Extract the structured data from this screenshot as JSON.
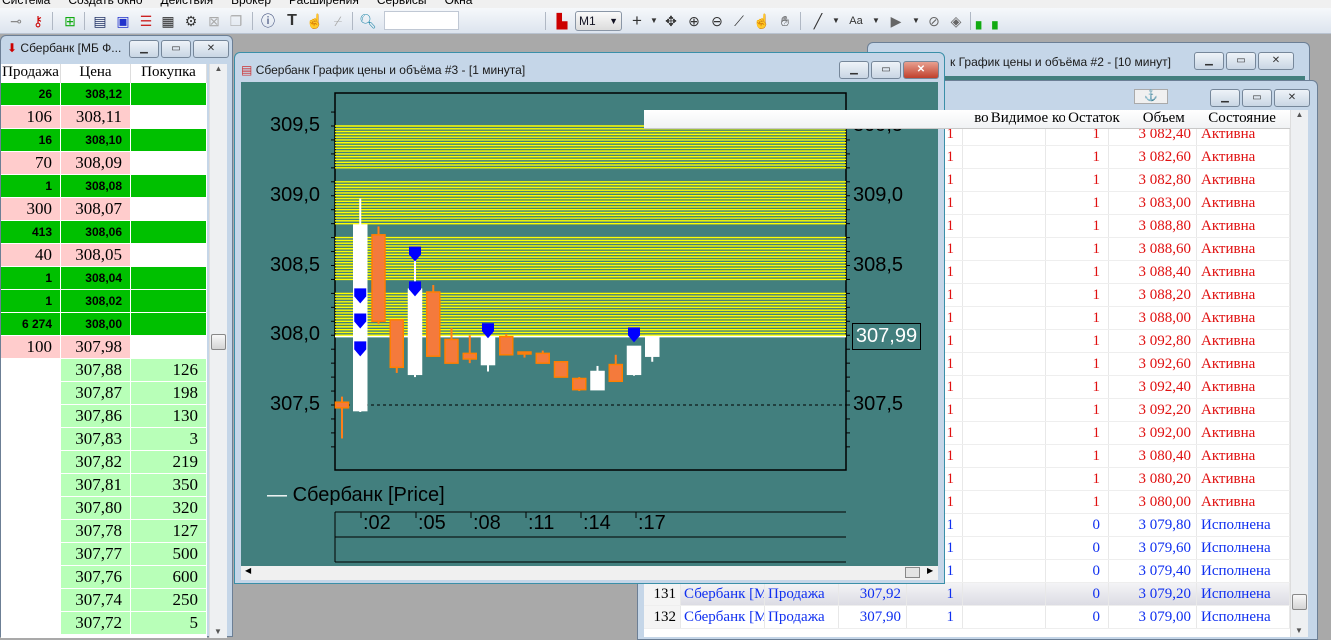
{
  "menu": [
    "Система",
    "Создать окно",
    "Действия",
    "Брокер",
    "Расширения",
    "Сервисы",
    "Окна"
  ],
  "toolbar": {
    "timeframe": "M1",
    "search_value": "",
    "font_button": "Aa"
  },
  "orderbook": {
    "title": "Сбербанк [МБ Ф...",
    "columns": [
      "Продажа",
      "Цена",
      "Покупка"
    ],
    "asks": [
      {
        "sell": "26",
        "price": "308,12",
        "style": "g"
      },
      {
        "sell": "106",
        "price": "308,11",
        "style": "p"
      },
      {
        "sell": "16",
        "price": "308,10",
        "style": "g"
      },
      {
        "sell": "70",
        "price": "308,09",
        "style": "p"
      },
      {
        "sell": "1",
        "price": "308,08",
        "style": "g"
      },
      {
        "sell": "300",
        "price": "308,07",
        "style": "p"
      },
      {
        "sell": "413",
        "price": "308,06",
        "style": "g"
      },
      {
        "sell": "40",
        "price": "308,05",
        "style": "p"
      },
      {
        "sell": "1",
        "price": "308,04",
        "style": "g"
      },
      {
        "sell": "1",
        "price": "308,02",
        "style": "g"
      },
      {
        "sell": "6 274",
        "price": "308,00",
        "style": "g"
      },
      {
        "sell": "100",
        "price": "307,98",
        "style": "p"
      }
    ],
    "bids": [
      {
        "price": "307,88",
        "buy": "126"
      },
      {
        "price": "307,87",
        "buy": "198"
      },
      {
        "price": "307,86",
        "buy": "130"
      },
      {
        "price": "307,83",
        "buy": "3"
      },
      {
        "price": "307,82",
        "buy": "219"
      },
      {
        "price": "307,81",
        "buy": "350"
      },
      {
        "price": "307,80",
        "buy": "320"
      },
      {
        "price": "307,78",
        "buy": "127"
      },
      {
        "price": "307,77",
        "buy": "500"
      },
      {
        "price": "307,76",
        "buy": "600"
      },
      {
        "price": "307,74",
        "buy": "250"
      },
      {
        "price": "307,72",
        "buy": "5"
      }
    ]
  },
  "chart2": {
    "title": "к График цены и объёма #2 - [10 минут]"
  },
  "chart3": {
    "title": "Сбербанк График цены и объёма #3 - [1 минута]",
    "legend": "Сбербанк [Price]",
    "last_price": "307,99"
  },
  "orders": {
    "columns": [
      "во",
      "Видимое ко.",
      "Остаток",
      "Объем",
      "Состояние"
    ],
    "rows": [
      {
        "qty": "1",
        "rest": "1",
        "vol": "3 082,40",
        "state": "Активна",
        "s": "act"
      },
      {
        "qty": "1",
        "rest": "1",
        "vol": "3 082,60",
        "state": "Активна",
        "s": "act"
      },
      {
        "qty": "1",
        "rest": "1",
        "vol": "3 082,80",
        "state": "Активна",
        "s": "act"
      },
      {
        "qty": "1",
        "rest": "1",
        "vol": "3 083,00",
        "state": "Активна",
        "s": "act"
      },
      {
        "qty": "1",
        "rest": "1",
        "vol": "3 088,80",
        "state": "Активна",
        "s": "act"
      },
      {
        "qty": "1",
        "rest": "1",
        "vol": "3 088,60",
        "state": "Активна",
        "s": "act"
      },
      {
        "qty": "1",
        "rest": "1",
        "vol": "3 088,40",
        "state": "Активна",
        "s": "act"
      },
      {
        "qty": "1",
        "rest": "1",
        "vol": "3 088,20",
        "state": "Активна",
        "s": "act"
      },
      {
        "qty": "1",
        "rest": "1",
        "vol": "3 088,00",
        "state": "Активна",
        "s": "act"
      },
      {
        "qty": "1",
        "rest": "1",
        "vol": "3 092,80",
        "state": "Активна",
        "s": "act"
      },
      {
        "qty": "1",
        "rest": "1",
        "vol": "3 092,60",
        "state": "Активна",
        "s": "act"
      },
      {
        "qty": "1",
        "rest": "1",
        "vol": "3 092,40",
        "state": "Активна",
        "s": "act"
      },
      {
        "qty": "1",
        "rest": "1",
        "vol": "3 092,20",
        "state": "Активна",
        "s": "act"
      },
      {
        "qty": "1",
        "rest": "1",
        "vol": "3 092,00",
        "state": "Активна",
        "s": "act"
      },
      {
        "qty": "1",
        "rest": "1",
        "vol": "3 080,40",
        "state": "Активна",
        "s": "act"
      },
      {
        "qty": "1",
        "rest": "1",
        "vol": "3 080,20",
        "state": "Активна",
        "s": "act"
      },
      {
        "qty": "1",
        "rest": "1",
        "vol": "3 080,00",
        "state": "Активна",
        "s": "act"
      },
      {
        "qty": "1",
        "rest": "0",
        "vol": "3 079,80",
        "state": "Исполнена",
        "s": "done"
      },
      {
        "qty": "1",
        "rest": "0",
        "vol": "3 079,60",
        "state": "Исполнена",
        "s": "done"
      },
      {
        "qty": "1",
        "rest": "0",
        "vol": "3 079,40",
        "state": "Исполнена",
        "s": "done"
      },
      {
        "num": "131",
        "sec": "Сбербанк [МБ",
        "op": "Продажа",
        "price": "307,92",
        "qty": "1",
        "rest": "0",
        "vol": "3 079,20",
        "state": "Исполнена",
        "s": "done",
        "selected": true
      },
      {
        "num": "132",
        "sec": "Сбербанк [МБ",
        "op": "Продажа",
        "price": "307,90",
        "qty": "1",
        "rest": "0",
        "vol": "3 079,00",
        "state": "Исполнена",
        "s": "done"
      }
    ]
  },
  "chart_data": {
    "type": "candlestick",
    "title": "Сбербанк График цены и объёма #3 - [1 минута]",
    "ylim": [
      307.2,
      309.7
    ],
    "yticks": [
      "309,5",
      "309,0",
      "308,5",
      "308,0",
      "307,5"
    ],
    "ytick_values": [
      309.5,
      309.0,
      308.5,
      308.0,
      307.5
    ],
    "xticks": [
      ":02",
      ":05",
      ":08",
      ":11",
      ":14",
      ":17"
    ],
    "reference_line": 307.5,
    "last_price": 307.99,
    "order_bands": [
      [
        309.2,
        309.5
      ],
      [
        308.8,
        309.1
      ],
      [
        308.4,
        308.7
      ],
      [
        308.0,
        308.3
      ]
    ],
    "candles": [
      {
        "o": 307.52,
        "h": 307.56,
        "l": 307.26,
        "c": 307.48
      },
      {
        "o": 307.46,
        "h": 308.98,
        "l": 307.45,
        "c": 308.79
      },
      {
        "o": 308.72,
        "h": 308.78,
        "l": 308.08,
        "c": 308.1
      },
      {
        "o": 308.11,
        "h": 308.11,
        "l": 307.73,
        "c": 307.77
      },
      {
        "o": 307.72,
        "h": 308.58,
        "l": 307.7,
        "c": 308.33
      },
      {
        "o": 308.31,
        "h": 308.36,
        "l": 307.85,
        "c": 307.85
      },
      {
        "o": 307.97,
        "h": 308.05,
        "l": 307.8,
        "c": 307.8
      },
      {
        "o": 307.87,
        "h": 308.0,
        "l": 307.8,
        "c": 307.83
      },
      {
        "o": 307.79,
        "h": 307.99,
        "l": 307.74,
        "c": 307.99
      },
      {
        "o": 307.99,
        "h": 308.01,
        "l": 307.86,
        "c": 307.86
      },
      {
        "o": 307.88,
        "h": 307.88,
        "l": 307.84,
        "c": 307.87
      },
      {
        "o": 307.87,
        "h": 307.89,
        "l": 307.8,
        "c": 307.8
      },
      {
        "o": 307.81,
        "h": 307.81,
        "l": 307.7,
        "c": 307.7
      },
      {
        "o": 307.69,
        "h": 307.7,
        "l": 307.6,
        "c": 307.61
      },
      {
        "o": 307.61,
        "h": 307.78,
        "l": 307.61,
        "c": 307.74
      },
      {
        "o": 307.79,
        "h": 307.86,
        "l": 307.67,
        "c": 307.67
      },
      {
        "o": 307.72,
        "h": 307.92,
        "l": 307.71,
        "c": 307.92
      },
      {
        "o": 307.85,
        "h": 307.99,
        "l": 307.81,
        "c": 307.99
      }
    ],
    "trade_markers": [
      {
        "candle": 1,
        "price": 308.25
      },
      {
        "candle": 1,
        "price": 308.07
      },
      {
        "candle": 1,
        "price": 307.87
      },
      {
        "candle": 4,
        "price": 308.55
      },
      {
        "candle": 4,
        "price": 308.3
      },
      {
        "candle": 8,
        "price": 308.0
      },
      {
        "candle": 16,
        "price": 307.97
      }
    ],
    "colors": {
      "bg": "#427f7e",
      "up": "#ffffff",
      "down": "#f47a3c",
      "band": "#ffff00",
      "marker": "#0000ff"
    }
  }
}
